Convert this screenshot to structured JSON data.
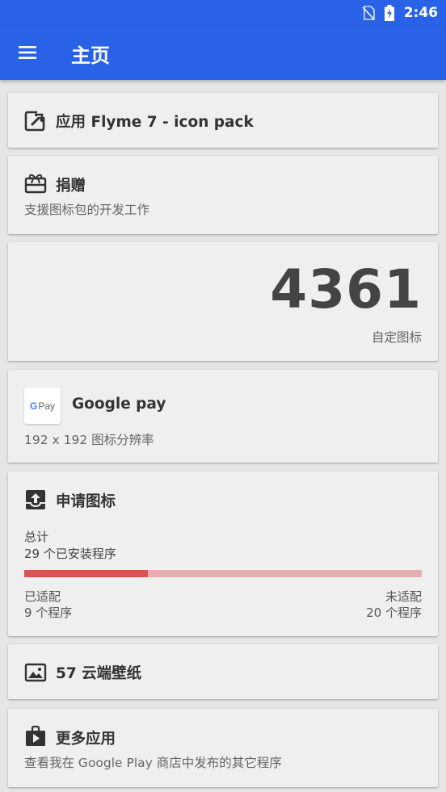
{
  "status_bar": {
    "time": "2:46"
  },
  "app_bar": {
    "title": "主页"
  },
  "cards": {
    "apply": {
      "title": "应用 Flyme 7 - icon pack"
    },
    "donate": {
      "title": "捐赠",
      "subtitle": "支援图标包的开发工作"
    },
    "icon_count": {
      "value": "4361",
      "caption": "自定图标"
    },
    "preview": {
      "badge_g": "G",
      "badge_text": "Pay",
      "title": "Google pay",
      "subtitle": "192 x 192 图标分辨率"
    },
    "request": {
      "title": "申请图标",
      "total_label": "总计",
      "total_value": "29 个已安装程序",
      "matched_label": "已适配",
      "matched_value": "9 个程序",
      "unmatched_label": "未适配",
      "unmatched_value": "20 个程序",
      "progress_fraction": 0.31
    },
    "wallpapers": {
      "title": "57 云端壁纸"
    },
    "more_apps": {
      "title": "更多应用",
      "subtitle": "查看我在 Google Play 商店中发布的其它程序"
    }
  },
  "colors": {
    "app_bar": "#2962e6",
    "progress_fill": "#d9534f",
    "progress_track": "#e6aeae"
  }
}
